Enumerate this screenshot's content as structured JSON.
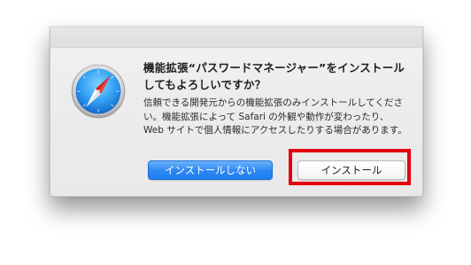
{
  "dialog": {
    "title": "機能拡張“パスワードマネージャー”をインストールしてもよろしいですか？",
    "message": "信頼できる開発元からの機能拡張のみインストールしてください。機能拡張によって Safari の外観や動作が変わったり、Web サイトで個人情報にアクセスしたりする場合があります。",
    "icon": "safari-compass-icon",
    "buttons": {
      "primary_label": "インストールしない",
      "secondary_label": "インストール"
    }
  },
  "annotation": {
    "highlight_color": "#e3000f"
  },
  "colors": {
    "primary_button": "#2b86f2",
    "dialog_background": "#ececec"
  }
}
